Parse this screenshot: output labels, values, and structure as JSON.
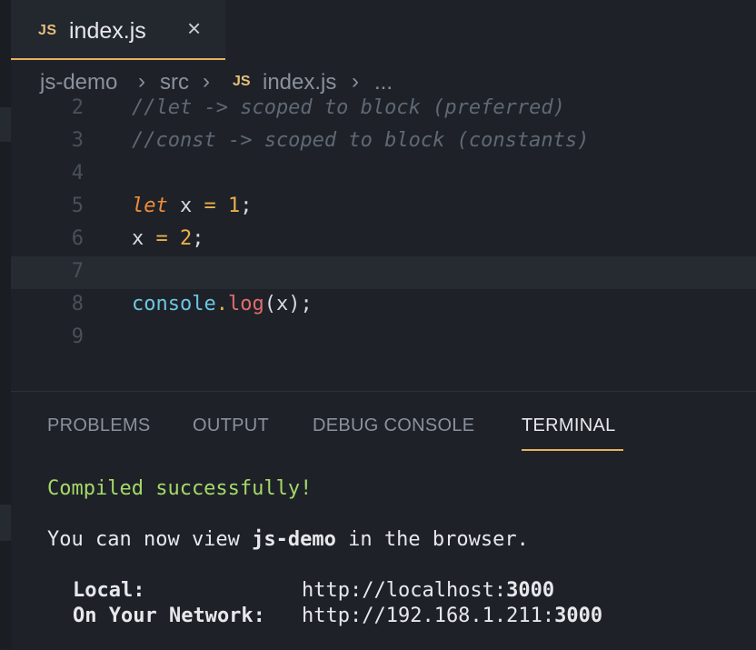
{
  "tab": {
    "icon_label": "JS",
    "title": "index.js",
    "close": "×"
  },
  "breadcrumb": {
    "project": "js-demo",
    "folder": "src",
    "icon_label": "JS",
    "file": "index.js",
    "more": "...",
    "sep": "›"
  },
  "editor": {
    "lines": [
      {
        "num": "2",
        "text": "//let -> scoped to block (preferred)"
      },
      {
        "num": "3",
        "text": "//const -> scoped to block (constants)"
      },
      {
        "num": "4",
        "text": ""
      },
      {
        "num": "5",
        "kw": "let",
        "var": " x ",
        "op": "=",
        "val": " 1",
        "end": ";"
      },
      {
        "num": "6",
        "var": "x ",
        "op": "=",
        "val": " 2",
        "end": ";"
      },
      {
        "num": "7",
        "text": ""
      },
      {
        "num": "8",
        "obj": "console",
        "dot": ".",
        "fn": "log",
        "args": "(x);"
      },
      {
        "num": "9",
        "text": ""
      }
    ]
  },
  "panel": {
    "tabs": [
      "PROBLEMS",
      "OUTPUT",
      "DEBUG CONSOLE",
      "TERMINAL"
    ],
    "active_tab": "TERMINAL"
  },
  "terminal": {
    "compiled": "Compiled successfully!",
    "view_pre": "You can now view ",
    "app": "js-demo",
    "view_post": " in the browser.",
    "local_label": "Local:",
    "local_url_pre": "http://localhost:",
    "local_port": "3000",
    "network_label": "On Your Network:",
    "network_url_pre": "http://192.168.1.211:",
    "network_port": "3000"
  },
  "colors": {
    "accent": "#e5b05c",
    "background": "#1e2228",
    "success": "#a6d86a"
  }
}
